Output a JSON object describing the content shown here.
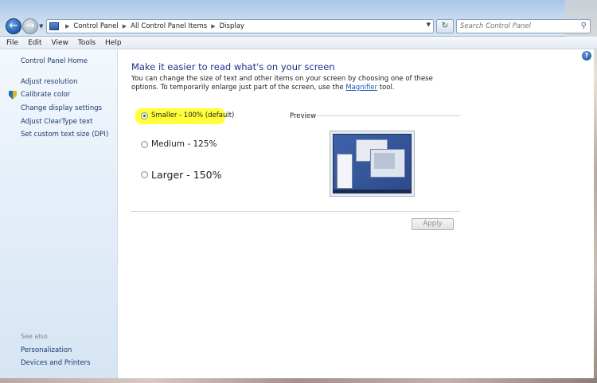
{
  "window": {
    "address_crumbs": [
      "Control Panel",
      "All Control Panel Items",
      "Display"
    ],
    "search_placeholder": "Search Control Panel"
  },
  "menubar": {
    "items": [
      "File",
      "Edit",
      "View",
      "Tools",
      "Help"
    ]
  },
  "sidebar": {
    "home": "Control Panel Home",
    "items": [
      {
        "label": "Adjust resolution",
        "icon": "none"
      },
      {
        "label": "Calibrate color",
        "icon": "shield-icon"
      },
      {
        "label": "Change display settings",
        "icon": "none"
      },
      {
        "label": "Adjust ClearType text",
        "icon": "none"
      },
      {
        "label": "Set custom text size (DPI)",
        "icon": "none"
      }
    ],
    "see_also_label": "See also",
    "see_also": [
      "Personalization",
      "Devices and Printers"
    ]
  },
  "main": {
    "heading": "Make it easier to read what's on your screen",
    "description_before": "You can change the size of text and other items on your screen by choosing one of these options. To temporarily enlarge just part of the screen, use the ",
    "description_link": "Magnifier",
    "description_after": " tool.",
    "options": [
      {
        "label": "Smaller - 100% (default)",
        "checked": true
      },
      {
        "label": "Medium - 125%",
        "checked": false
      },
      {
        "label": "Larger - 150%",
        "checked": false
      }
    ],
    "preview_label": "Preview",
    "apply_label": "Apply",
    "highlight_color": "#ffff3a"
  }
}
